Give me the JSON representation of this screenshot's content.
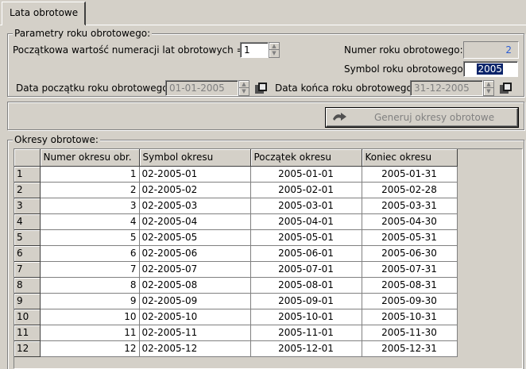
{
  "tab": {
    "label": "Lata obrotowe"
  },
  "params": {
    "legend": "Parametry roku obrotowego:",
    "start_numbering_label": "Początkowa wartość numeracji lat obrotowych =",
    "start_numbering_value": "1",
    "year_number_label": "Numer roku obrotowego:",
    "year_number_value": "2",
    "year_symbol_label": "Symbol roku obrotowego:",
    "year_symbol_value": "2005",
    "start_date_label": "Data początku roku obrotowego:",
    "start_date_value": "01-01-2005",
    "end_date_label": "Data końca roku obrotowego:",
    "end_date_value": "31-12-2005"
  },
  "actions": {
    "generate_label": "Generuj okresy obrotowe"
  },
  "periods": {
    "legend": "Okresy obrotowe:",
    "columns": [
      "Numer okresu obr.",
      "Symbol okresu",
      "Początek okresu",
      "Koniec okresu"
    ],
    "rows": [
      {
        "n": "1",
        "num": "1",
        "sym": "02-2005-01",
        "start": "2005-01-01",
        "end": "2005-01-31"
      },
      {
        "n": "2",
        "num": "2",
        "sym": "02-2005-02",
        "start": "2005-02-01",
        "end": "2005-02-28"
      },
      {
        "n": "3",
        "num": "3",
        "sym": "02-2005-03",
        "start": "2005-03-01",
        "end": "2005-03-31"
      },
      {
        "n": "4",
        "num": "4",
        "sym": "02-2005-04",
        "start": "2005-04-01",
        "end": "2005-04-30"
      },
      {
        "n": "5",
        "num": "5",
        "sym": "02-2005-05",
        "start": "2005-05-01",
        "end": "2005-05-31"
      },
      {
        "n": "6",
        "num": "6",
        "sym": "02-2005-06",
        "start": "2005-06-01",
        "end": "2005-06-30"
      },
      {
        "n": "7",
        "num": "7",
        "sym": "02-2005-07",
        "start": "2005-07-01",
        "end": "2005-07-31"
      },
      {
        "n": "8",
        "num": "8",
        "sym": "02-2005-08",
        "start": "2005-08-01",
        "end": "2005-08-31"
      },
      {
        "n": "9",
        "num": "9",
        "sym": "02-2005-09",
        "start": "2005-09-01",
        "end": "2005-09-30"
      },
      {
        "n": "10",
        "num": "10",
        "sym": "02-2005-10",
        "start": "2005-10-01",
        "end": "2005-10-31"
      },
      {
        "n": "11",
        "num": "11",
        "sym": "02-2005-11",
        "start": "2005-11-01",
        "end": "2005-11-30"
      },
      {
        "n": "12",
        "num": "12",
        "sym": "02-2005-12",
        "start": "2005-12-01",
        "end": "2005-12-31"
      }
    ]
  },
  "colors": {
    "accent_blue": "#2a5cd4",
    "selection": "#0a246a",
    "face": "#d4d0c8"
  },
  "icons": {
    "calendar": "calendar-icon",
    "generate": "arrow-icon",
    "spin": "spinner-arrows-icon"
  }
}
